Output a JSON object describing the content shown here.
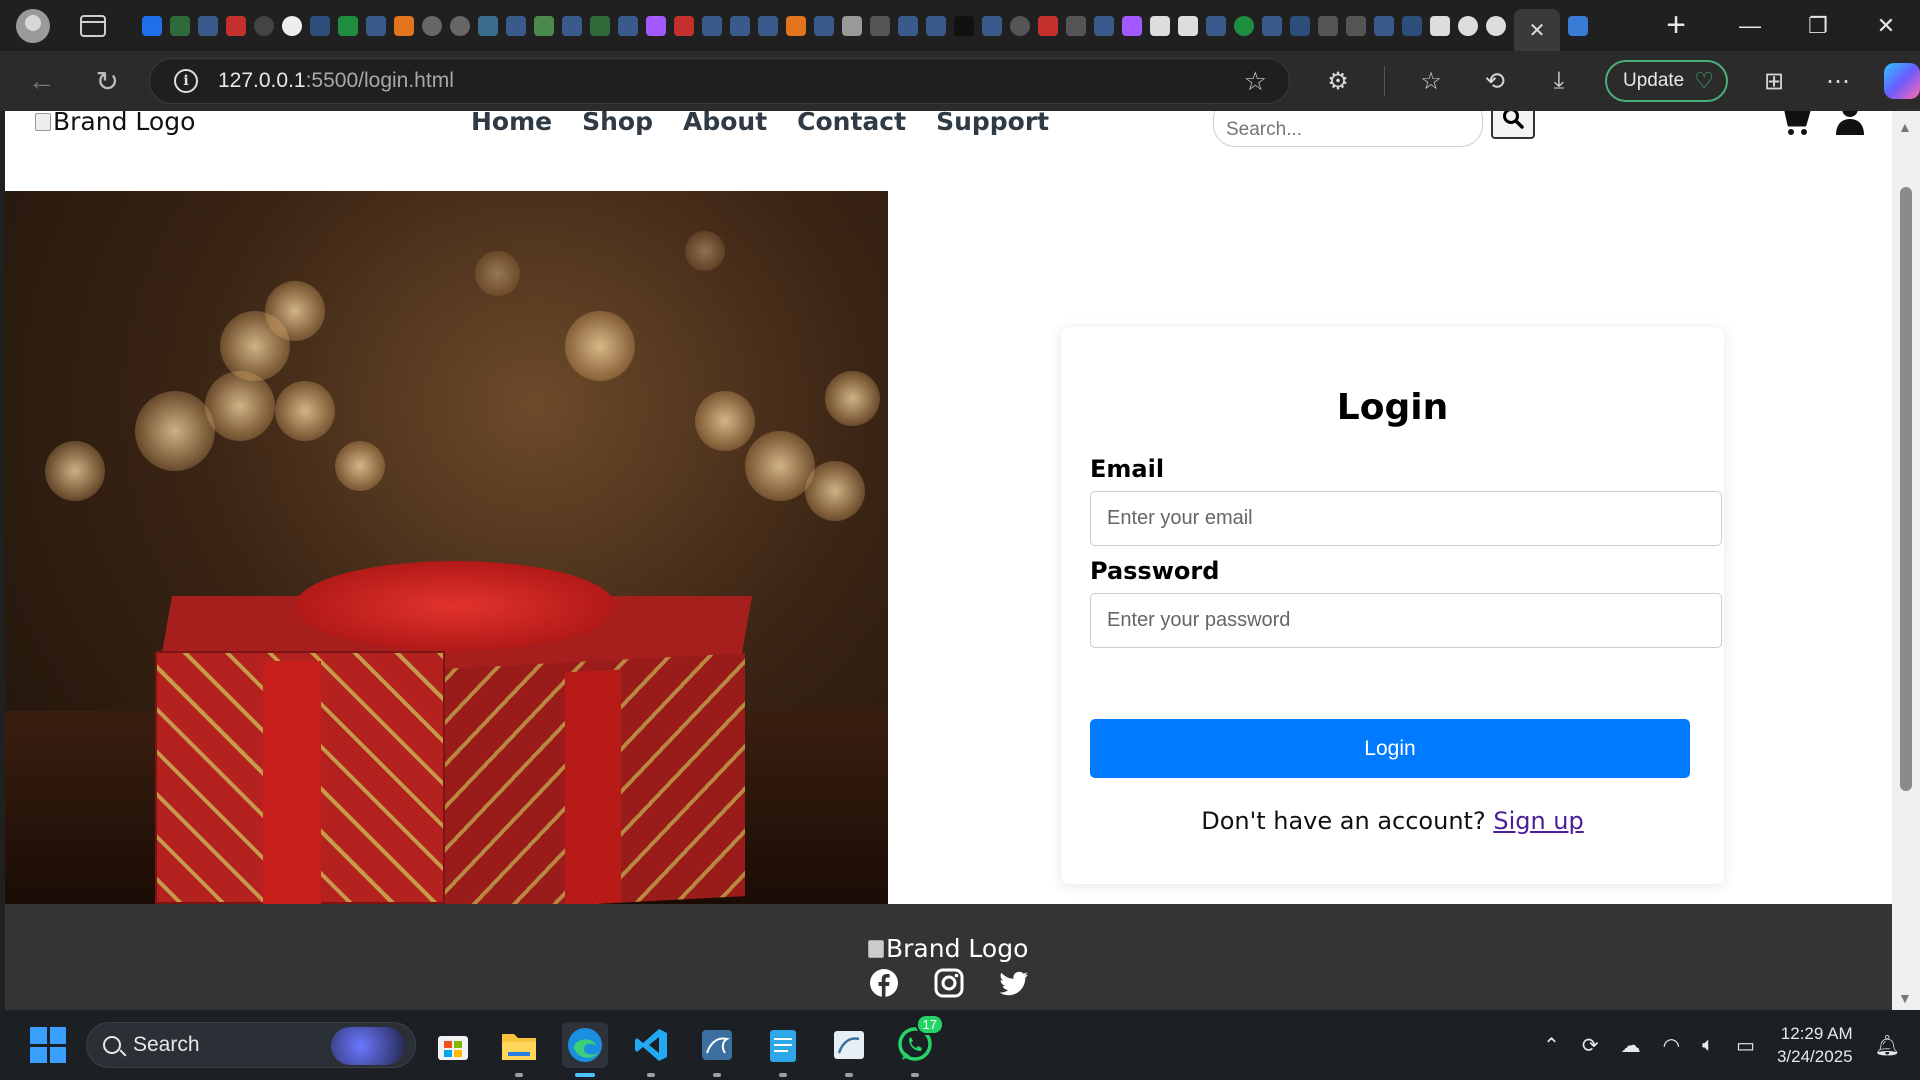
{
  "browser": {
    "url_host": "127.0.0.1",
    "url_path": ":5500/login.html",
    "update_label": "Update"
  },
  "header": {
    "brand_alt": "Brand Logo",
    "nav": [
      "Home",
      "Shop",
      "About",
      "Contact",
      "Support"
    ],
    "search_placeholder": "Search..."
  },
  "hero": {
    "image": "gift-box-photo"
  },
  "login": {
    "title": "Login",
    "email_label": "Email",
    "email_placeholder": "Enter your email",
    "password_label": "Password",
    "password_placeholder": "Enter your password",
    "button_label": "Login",
    "signup_prompt": "Don't have an account?",
    "signup_link": "Sign up"
  },
  "footer": {
    "brand_alt": "Brand Logo",
    "socials": [
      "facebook-icon",
      "instagram-icon",
      "twitter-icon"
    ]
  },
  "taskbar": {
    "search_label": "Search",
    "whatsapp_badge": "17",
    "time": "12:29 AM",
    "date": "3/24/2025"
  },
  "colors": {
    "primary_button": "#007bff",
    "footer_bg": "#343434",
    "signup_link": "#4b1f9a"
  }
}
